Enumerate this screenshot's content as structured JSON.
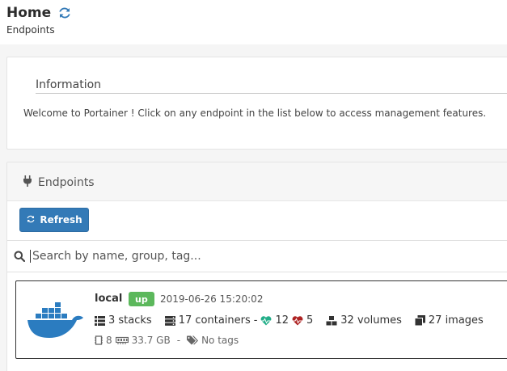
{
  "header": {
    "title": "Home",
    "breadcrumb": "Endpoints"
  },
  "information": {
    "title": "Information",
    "message": "Welcome to Portainer ! Click on any endpoint in the list below to access management features."
  },
  "endpoints": {
    "title": "Endpoints",
    "refresh_label": "Refresh",
    "search_placeholder": "Search by name, group, tag...",
    "items": [
      {
        "name": "local",
        "status": "up",
        "date": "2019-06-26 15:20:02",
        "stacks": "3 stacks",
        "containers": "17 containers",
        "separator": "-",
        "healthy": "12",
        "unhealthy": "5",
        "volumes": "32 volumes",
        "images": "27 images",
        "cpu": "8",
        "memory": "33.7 GB",
        "meta_separator": "-",
        "tags": "No tags"
      }
    ]
  },
  "colors": {
    "primary": "#337ab7",
    "status_up": "#5cb85c",
    "healthy": "#23ae89",
    "unhealthy": "#ae2323",
    "docker_blue": "#2b7cc0"
  }
}
